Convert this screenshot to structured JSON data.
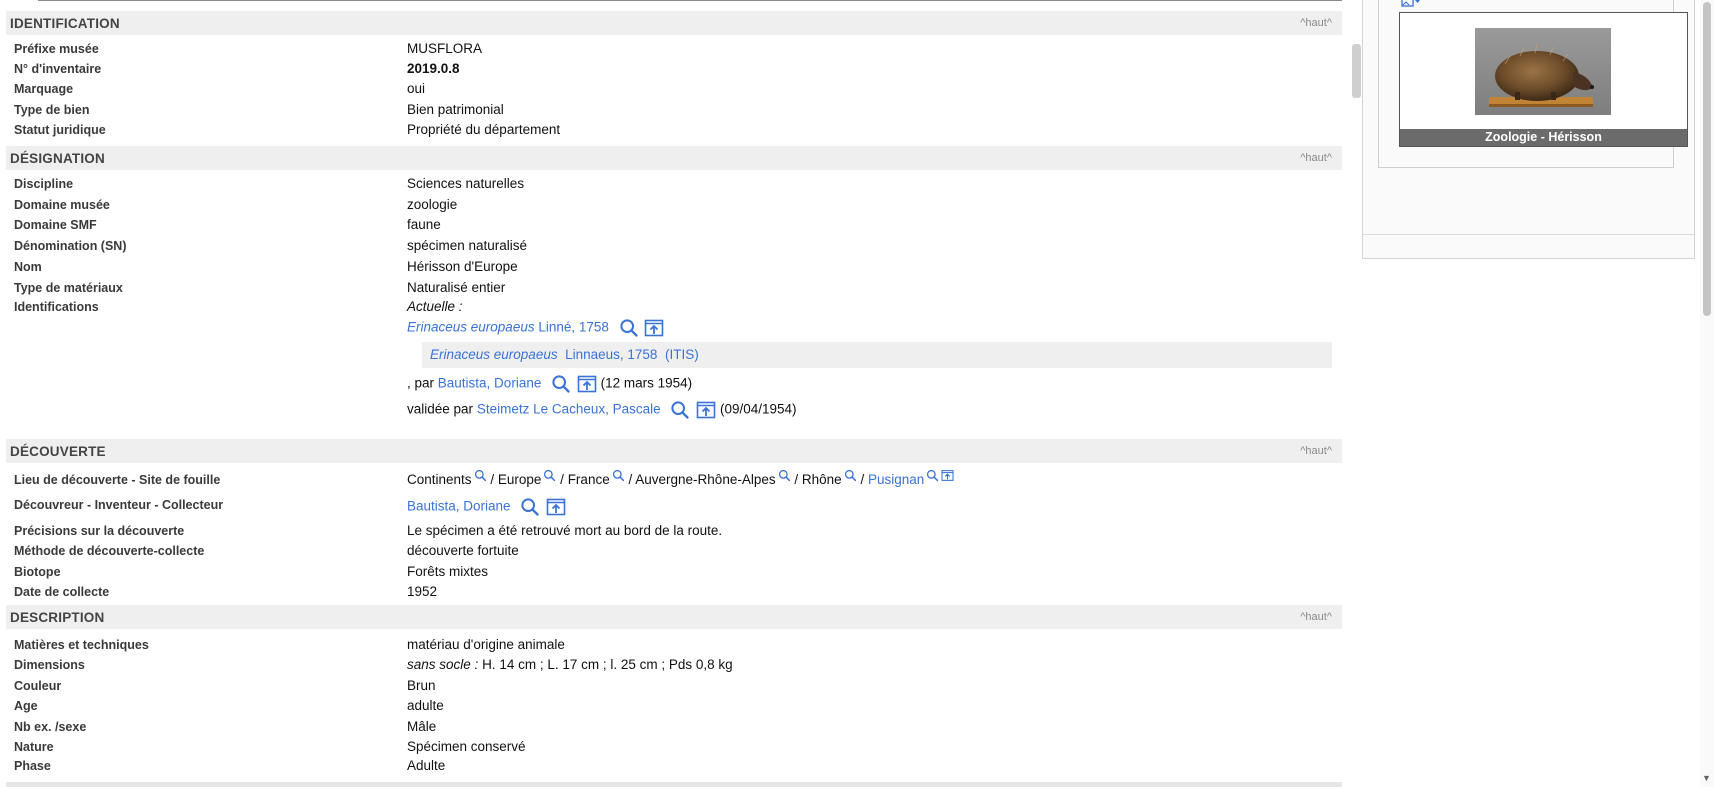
{
  "nav": {
    "haut": "^haut^"
  },
  "sections": {
    "identification": "IDENTIFICATION",
    "designation": "DÉSIGNATION",
    "decouverte": "DÉCOUVERTE",
    "description": "DESCRIPTION"
  },
  "identification": {
    "rows": [
      {
        "label": "Préfixe musée",
        "value": "MUSFLORA"
      },
      {
        "label": "N° d'inventaire",
        "value": "2019.0.8"
      },
      {
        "label": "Marquage",
        "value": "oui"
      },
      {
        "label": "Type de bien",
        "value": "Bien patrimonial"
      },
      {
        "label": "Statut juridique",
        "value": "Propriété du département"
      }
    ]
  },
  "designation": {
    "rows": [
      {
        "label": "Discipline",
        "value": "Sciences naturelles"
      },
      {
        "label": "Domaine musée",
        "value": "zoologie"
      },
      {
        "label": "Domaine SMF",
        "value": "faune"
      },
      {
        "label": "Dénomination (SN)",
        "value": "spécimen naturalisé"
      },
      {
        "label": "Nom",
        "value": "Hérisson d'Europe"
      },
      {
        "label": "Type de matériaux",
        "value": "Naturalisé entier"
      },
      {
        "label": "Identifications",
        "value": "Actuelle :"
      }
    ],
    "identification": {
      "taxon_italic": "Erinaceus europaeus",
      "taxon_author": "Linné, 1758",
      "itis_italic": "Erinaceus europaeus",
      "itis_author": "Linnaeus, 1758",
      "itis_source": "(ITIS)",
      "par_prefix": ", par",
      "par_person": "Bautista, Doriane",
      "par_date": "(12 mars 1954)",
      "validee_prefix": "validée par",
      "validee_person": "Steimetz Le Cacheux, Pascale",
      "validee_date": "(09/04/1954)"
    }
  },
  "decouverte": {
    "lieu_label": "Lieu de découverte - Site de fouille",
    "lieu_path": [
      "Continents",
      "Europe",
      "France",
      "Auvergne-Rhône-Alpes",
      "Rhône"
    ],
    "lieu_sep": "/",
    "lieu_final": "Pusignan",
    "decouvreur_label": "Découvreur - Inventeur - Collecteur",
    "decouvreur_value": "Bautista, Doriane",
    "rows": [
      {
        "label": "Précisions sur la découverte",
        "value": "Le spécimen a été retrouvé mort au bord de la route."
      },
      {
        "label": "Méthode de découverte-collecte",
        "value": "découverte fortuite"
      },
      {
        "label": "Biotope",
        "value": "Forêts mixtes"
      },
      {
        "label": "Date de collecte",
        "value": "1952"
      }
    ]
  },
  "description": {
    "matieres_label": "Matières et techniques",
    "matieres_value": "matériau d'origine animale",
    "dimensions_label": "Dimensions",
    "dimensions_italic": "sans socle :",
    "dimensions_value": "H. 14 cm ; L. 17 cm ; l. 25 cm ; Pds 0,8  kg",
    "rows": [
      {
        "label": "Couleur",
        "value": "Brun"
      },
      {
        "label": "Age",
        "value": "adulte"
      },
      {
        "label": "Nb ex. /sexe",
        "value": "Mâle"
      },
      {
        "label": "Nature",
        "value": "Spécimen conservé"
      },
      {
        "label": "Phase",
        "value": "Adulte"
      }
    ]
  },
  "media": {
    "caption": "Zoologie - Hérisson"
  },
  "icons": {
    "search": "magnifier-icon",
    "open": "open-record-icon",
    "gallery": "image-gallery-icon",
    "thumb": "hedgehog-photo"
  },
  "colors": {
    "link": "#3a72d8",
    "header_bg": "#efefef",
    "caption_bg": "#6b6b6b"
  }
}
